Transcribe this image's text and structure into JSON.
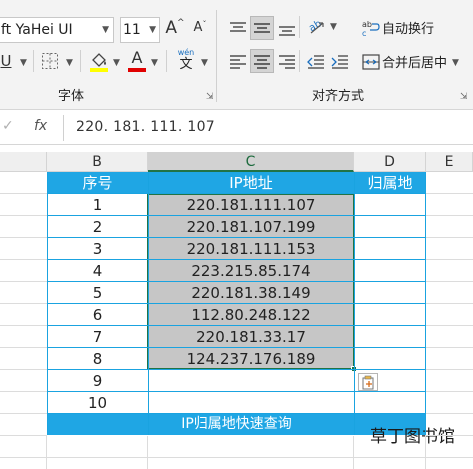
{
  "ribbon": {
    "font_name": "ft YaHei UI",
    "font_size": "11",
    "grow_font": "A",
    "shrink_font": "A",
    "underline": "U",
    "font_color": "A",
    "phonetic_top": "wén",
    "phonetic_bottom": "文",
    "wrap_text": "自动换行",
    "merge_center": "合并后居中",
    "group_font": "字体",
    "group_alignment": "对齐方式"
  },
  "formula_bar": {
    "fx": "fx",
    "value": "220. 181. 111. 107"
  },
  "columns": [
    "B",
    "C",
    "D",
    "E"
  ],
  "table": {
    "headers": [
      "序号",
      "IP地址",
      "归属地"
    ],
    "rows": [
      {
        "no": "1",
        "ip": "220.181.111.107"
      },
      {
        "no": "2",
        "ip": "220.181.107.199"
      },
      {
        "no": "3",
        "ip": "220.181.111.153"
      },
      {
        "no": "4",
        "ip": "223.215.85.174"
      },
      {
        "no": "5",
        "ip": "220.181.38.149"
      },
      {
        "no": "6",
        "ip": "112.80.248.122"
      },
      {
        "no": "7",
        "ip": "220.181.33.17"
      },
      {
        "no": "8",
        "ip": "124.237.176.189"
      },
      {
        "no": "9",
        "ip": ""
      },
      {
        "no": "10",
        "ip": ""
      }
    ],
    "footer": "IP归属地快速查询"
  },
  "watermark": "草丁图书馆",
  "colors": {
    "header_fill": "#1fa6e4",
    "header_text": "#ffffff",
    "table_border": "#1aa3e0",
    "selection_fill": "#c6c6c6",
    "selection_border": "#217346"
  }
}
